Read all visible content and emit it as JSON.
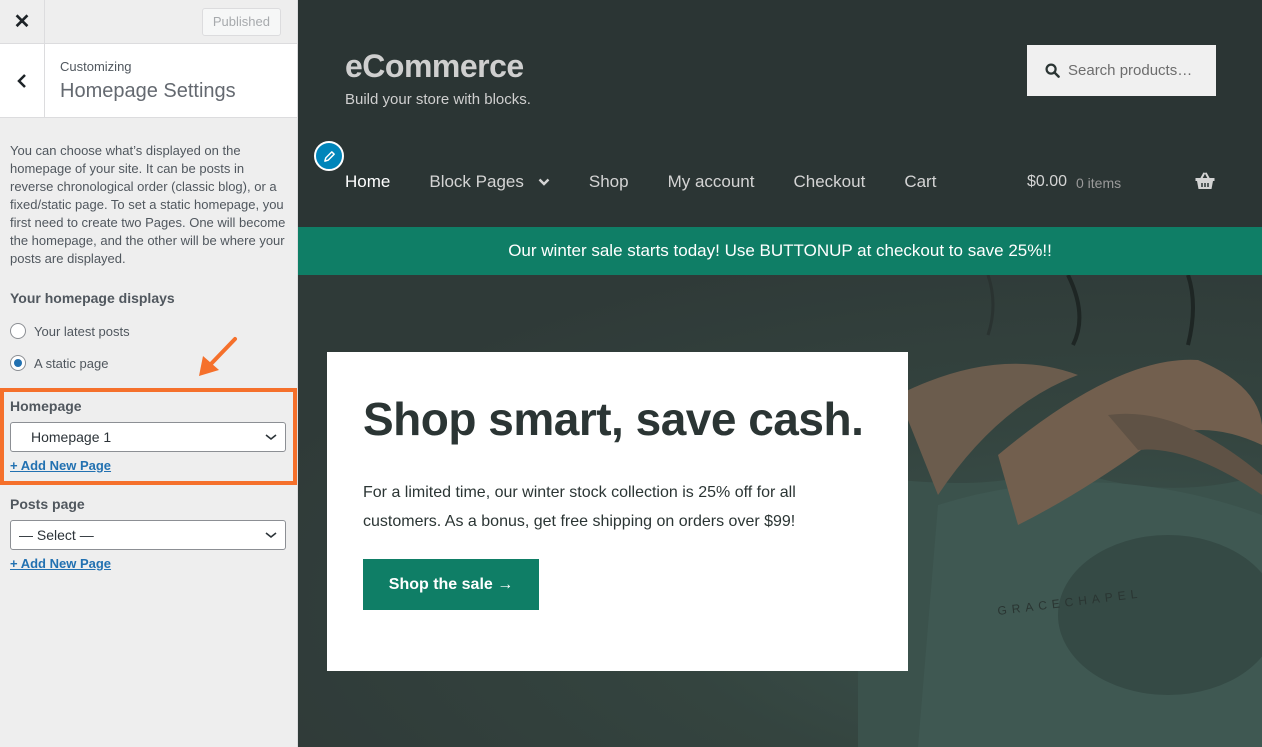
{
  "sidebar": {
    "close_label": "✕",
    "published_label": "Published",
    "breadcrumb": "Customizing",
    "title": "Homepage Settings",
    "description": "You can choose what’s displayed on the homepage of your site. It can be posts in reverse chronological order (classic blog), or a fixed/static page. To set a static homepage, you first need to create two Pages. One will become the homepage, and the other will be where your posts are displayed.",
    "homepage_displays": {
      "label": "Your homepage displays",
      "options": [
        {
          "label": "Your latest posts",
          "checked": false
        },
        {
          "label": "A static page",
          "checked": true
        }
      ]
    },
    "homepage_field": {
      "label": "Homepage",
      "selected": "Homepage 1",
      "add_link": "+ Add New Page"
    },
    "posts_page_field": {
      "label": "Posts page",
      "selected": "— Select —",
      "add_link": "+ Add New Page"
    },
    "annotation_color": "#f5702b",
    "accent_color": "#2271b1"
  },
  "preview": {
    "site_title": "eCommerce",
    "site_tagline": "Build your store with blocks.",
    "search": {
      "placeholder": "Search products…"
    },
    "nav": [
      {
        "label": "Home",
        "active": true
      },
      {
        "label": "Block Pages",
        "has_dropdown": true
      },
      {
        "label": "Shop"
      },
      {
        "label": "My account"
      },
      {
        "label": "Checkout"
      },
      {
        "label": "Cart"
      }
    ],
    "cart": {
      "total": "$0.00",
      "items": "0 items"
    },
    "notice": "Our winter sale starts today! Use BUTTONUP at checkout to save 25%!!",
    "hero": {
      "heading": "Shop smart, save cash.",
      "text": "For a limited time, our winter stock collection is 25% off for all customers. As a bonus, get free shipping on orders over $99!",
      "button": "Shop the sale →",
      "image_label": "GRACECHAPEL"
    },
    "colors": {
      "header_bg": "#2b3534",
      "brand_green": "#0f7e66",
      "edit_blue": "#0085ba"
    }
  }
}
